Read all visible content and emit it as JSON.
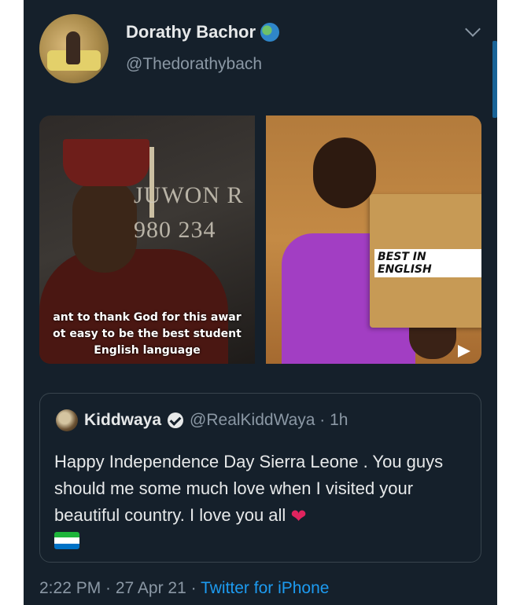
{
  "tweet": {
    "author_name": "Dorathy Bachor",
    "author_handle": "@Thedorathybach",
    "timestamp": "2:22 PM · 27 Apr 21 · ",
    "source": "Twitter for iPhone"
  },
  "media": {
    "left_caption_lines": [
      "ant to thank God for this awar",
      "ot easy to be the best student",
      "English language"
    ],
    "left_board_lines": [
      "JUWON R",
      "980 234"
    ],
    "right_label": "BEST IN ENGLISH"
  },
  "quoted_tweet": {
    "author_name": "Kiddwaya",
    "author_handle": "@RealKiddWaya · 1h",
    "text": "Happy Independence Day Sierra Leone . You guys should me some much love when I visited your beautiful country. I love you all",
    "flag_colors": [
      "#1eb53a",
      "#ffffff",
      "#0072c6"
    ]
  },
  "icons": [
    "verified-globe-icon",
    "chevron-down-icon",
    "verified-check-icon",
    "heart-emoji",
    "sierra-leone-flag-emoji",
    "play-icon"
  ]
}
